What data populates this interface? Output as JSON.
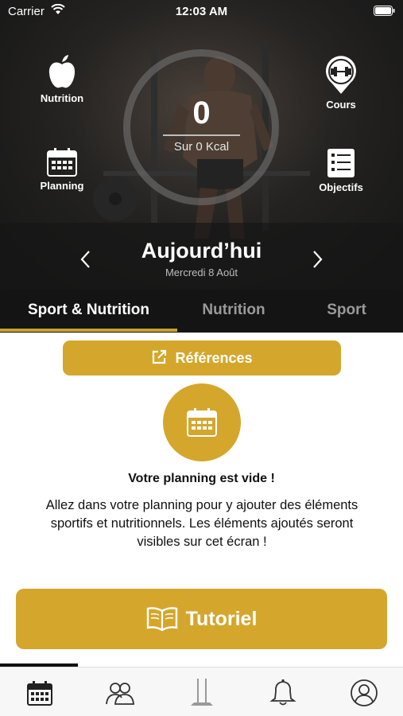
{
  "status_bar": {
    "carrier": "Carrier",
    "time": "12:03 AM"
  },
  "hero": {
    "kcal_value": "0",
    "kcal_subtitle": "Sur 0 Kcal",
    "buttons": {
      "nutrition": "Nutrition",
      "cours": "Cours",
      "planning": "Planning",
      "objectifs": "Objectifs"
    },
    "date_title": "Aujourd’hui",
    "date_subtitle": "Mercredi 8 Août"
  },
  "tabs": [
    {
      "label": "Sport & Nutrition",
      "active": true
    },
    {
      "label": "Nutrition",
      "active": false
    },
    {
      "label": "Sport",
      "active": false
    }
  ],
  "content": {
    "references_label": "Références",
    "empty_title": "Votre planning est vide !",
    "empty_description": "Allez dans votre planning pour y ajouter des éléments sportifs et nutritionnels. Les éléments ajoutés seront visibles sur cet écran !",
    "tutorial_label": "Tutoriel"
  },
  "tab_bar": {
    "items": [
      "calendar-icon",
      "group-icon",
      "gym-icon",
      "bell-icon",
      "profile-icon"
    ],
    "active_index": 0
  },
  "colors": {
    "accent": "#d4a72c",
    "dark": "#141414",
    "tab_inactive": "#9a9a9a"
  }
}
